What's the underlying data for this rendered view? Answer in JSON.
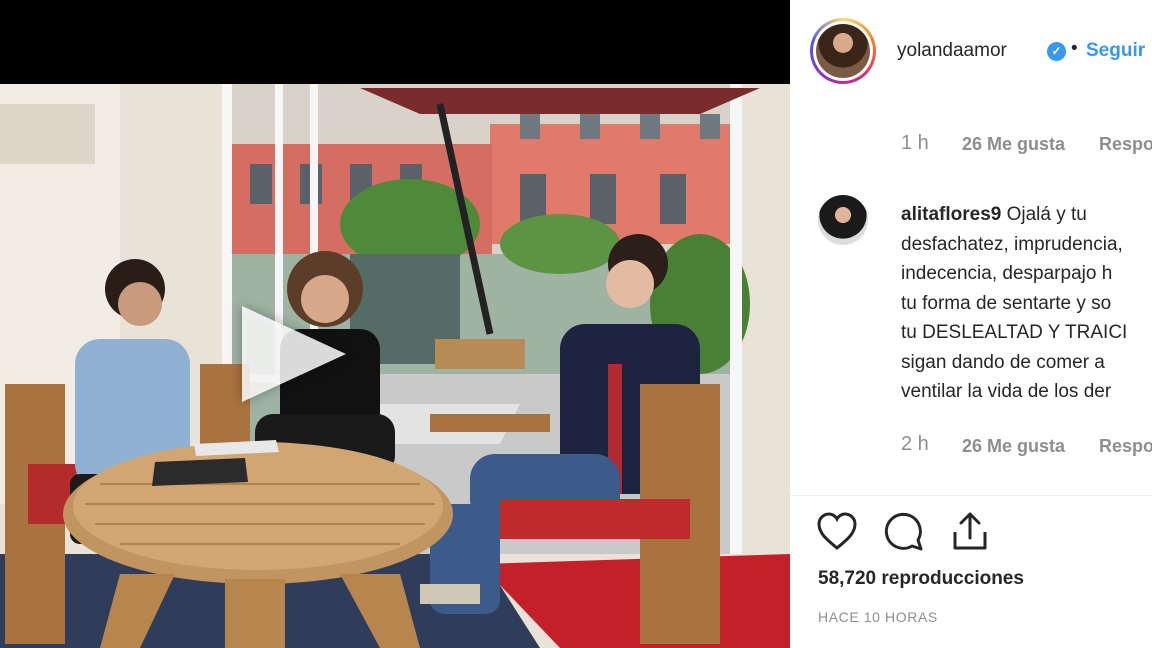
{
  "post": {
    "username": "yolandaamor",
    "separator": "•",
    "follow_label": "Seguir",
    "views_count": "58,720",
    "views_label": "reproducciones",
    "time_ago": "HACE 10 HORAS"
  },
  "comments": [
    {
      "time": "1 h",
      "likes": "26 Me gusta",
      "reply_label": "Responder"
    },
    {
      "username": "alitaflores9",
      "lines": [
        "Ojalá y tu",
        "desfachatez, imprudencia,",
        "indecencia, desparpajo h",
        "tu forma de sentarte y so",
        "tu DESLEALTAD Y TRAICI",
        "sigan dando de comer a",
        "ventilar la vida de los der"
      ],
      "time": "2 h",
      "likes": "26 Me gusta",
      "reply_label": "Responder"
    }
  ],
  "colors": {
    "link_blue": "#3897f0",
    "text": "#262626",
    "muted": "#8e8e8e"
  },
  "icons": [
    "play-icon",
    "verified-badge-icon",
    "heart-icon",
    "comment-icon",
    "share-icon"
  ]
}
